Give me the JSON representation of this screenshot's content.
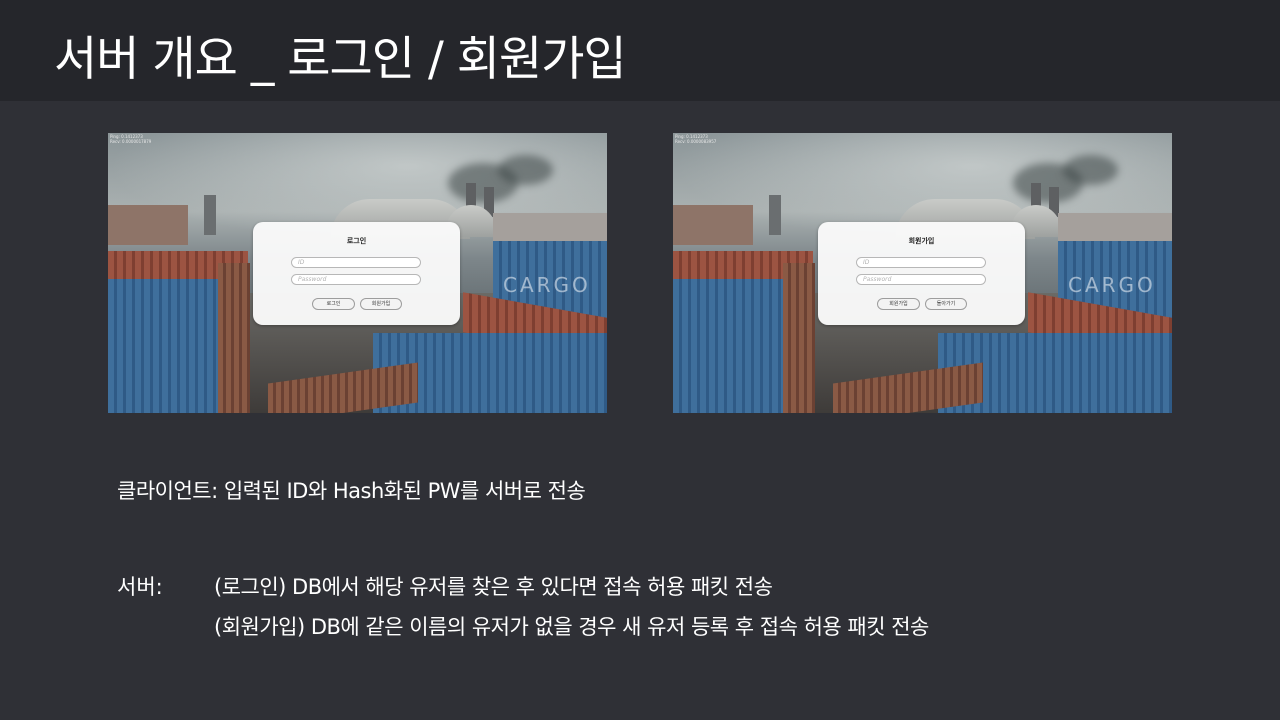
{
  "slide": {
    "title": "서버 개요 _ 로그인 / 회원가입"
  },
  "login_screen": {
    "dialog_title": "로그인",
    "id_placeholder": "ID",
    "password_placeholder": "Password",
    "buttons": [
      "로그인",
      "회원가입"
    ],
    "container_text": "CARGO",
    "hud_lines": [
      "Ping: 0.1412373",
      "Recv: 0.0000017879"
    ]
  },
  "signup_screen": {
    "dialog_title": "회원가입",
    "id_placeholder": "ID",
    "password_placeholder": "Password",
    "buttons": [
      "회원가입",
      "돌아가기"
    ],
    "container_text": "CARGO",
    "hud_lines": [
      "Ping: 0.1412373",
      "Recv: 0.0000083957"
    ]
  },
  "description": {
    "client_line": "클라이언트: 입력된 ID와 Hash화된 PW를 서버로 전송",
    "server_label": "서버:",
    "server_lines": [
      "(로그인) DB에서 해당 유저를 찾은 후 있다면 접속 허용 패킷 전송",
      "(회원가입) DB에 같은 이름의 유저가 없을 경우 새 유저 등록 후 접속 허용 패킷 전송"
    ]
  }
}
